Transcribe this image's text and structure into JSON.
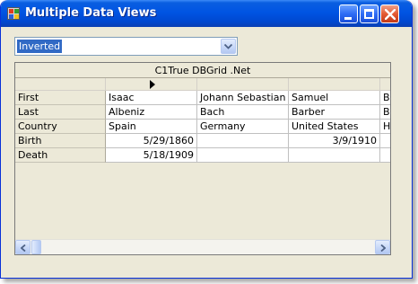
{
  "window": {
    "title": "Multiple Data Views"
  },
  "view_select": {
    "value": "Inverted"
  },
  "grid": {
    "caption": "C1True DBGrid .Net",
    "rows": [
      {
        "label": "First",
        "cells": [
          "Isaac",
          "Johann Sebastian",
          "Samuel",
          "B"
        ]
      },
      {
        "label": "Last",
        "cells": [
          "Albeniz",
          "Bach",
          "Barber",
          "B"
        ]
      },
      {
        "label": "Country",
        "cells": [
          "Spain",
          "Germany",
          "United States",
          "H"
        ]
      },
      {
        "label": "Birth",
        "cells": [
          "5/29/1860",
          "",
          "3/9/1910",
          ""
        ]
      },
      {
        "label": "Death",
        "cells": [
          "5/18/1909",
          "",
          "",
          ""
        ]
      }
    ]
  },
  "icons": {
    "app": "app-icon",
    "minimize": "minimize-icon",
    "maximize": "maximize-icon",
    "close": "close-icon",
    "dropdown": "chevron-down-icon",
    "row_pointer": "row-pointer-icon",
    "scroll_left": "chevron-left-icon",
    "scroll_right": "chevron-right-icon"
  },
  "colors": {
    "titlebar": "#0054e3",
    "selection": "#316ac5",
    "close_button": "#e35a33"
  }
}
